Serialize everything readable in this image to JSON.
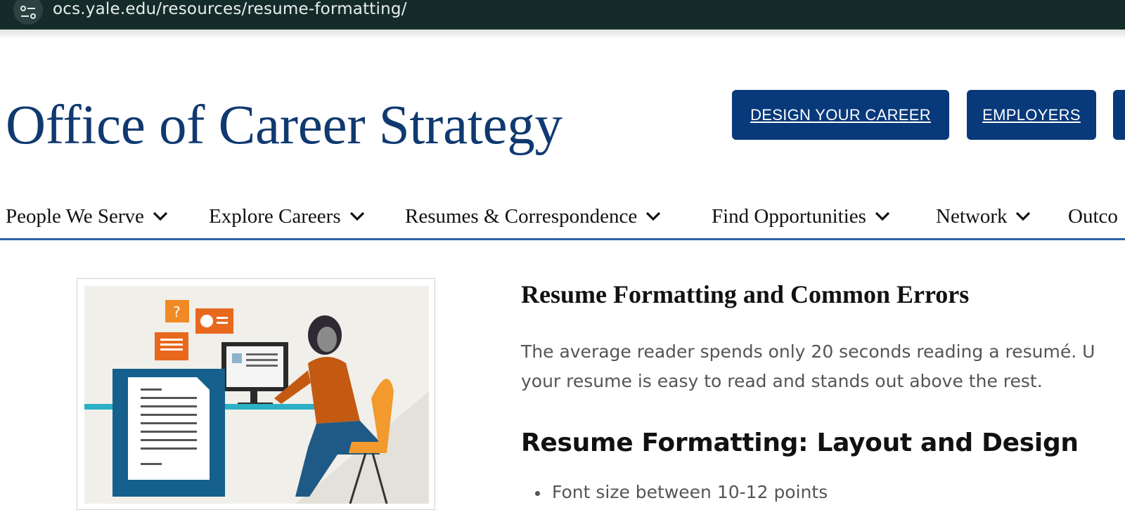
{
  "browser": {
    "url": "ocs.yale.edu/resources/resume-formatting/",
    "site_info_icon": "tune-icon"
  },
  "header": {
    "site_title": "Office of Career Strategy",
    "buttons": [
      {
        "label": "DESIGN YOUR CAREER"
      },
      {
        "label": "EMPLOYERS"
      },
      {
        "label": ""
      }
    ]
  },
  "nav": {
    "items": [
      {
        "label": "People We Serve"
      },
      {
        "label": "Explore Careers"
      },
      {
        "label": "Resumes & Correspondence"
      },
      {
        "label": "Find Opportunities"
      },
      {
        "label": "Network"
      },
      {
        "label": "Outco"
      }
    ]
  },
  "content": {
    "heading": "Resume Formatting and Common Errors",
    "intro_line1": "The average reader spends only 20 seconds reading a resumé. U",
    "intro_line2": "your resume is easy to read and stands out above the rest.",
    "subheading": "Resume Formatting: Layout and Design",
    "bullets": [
      "Font size between 10-12 points"
    ]
  },
  "colors": {
    "topbar": "#142b29",
    "brand_blue": "#0f3970",
    "button_blue": "#08397a",
    "nav_rule": "#2e62a8"
  }
}
